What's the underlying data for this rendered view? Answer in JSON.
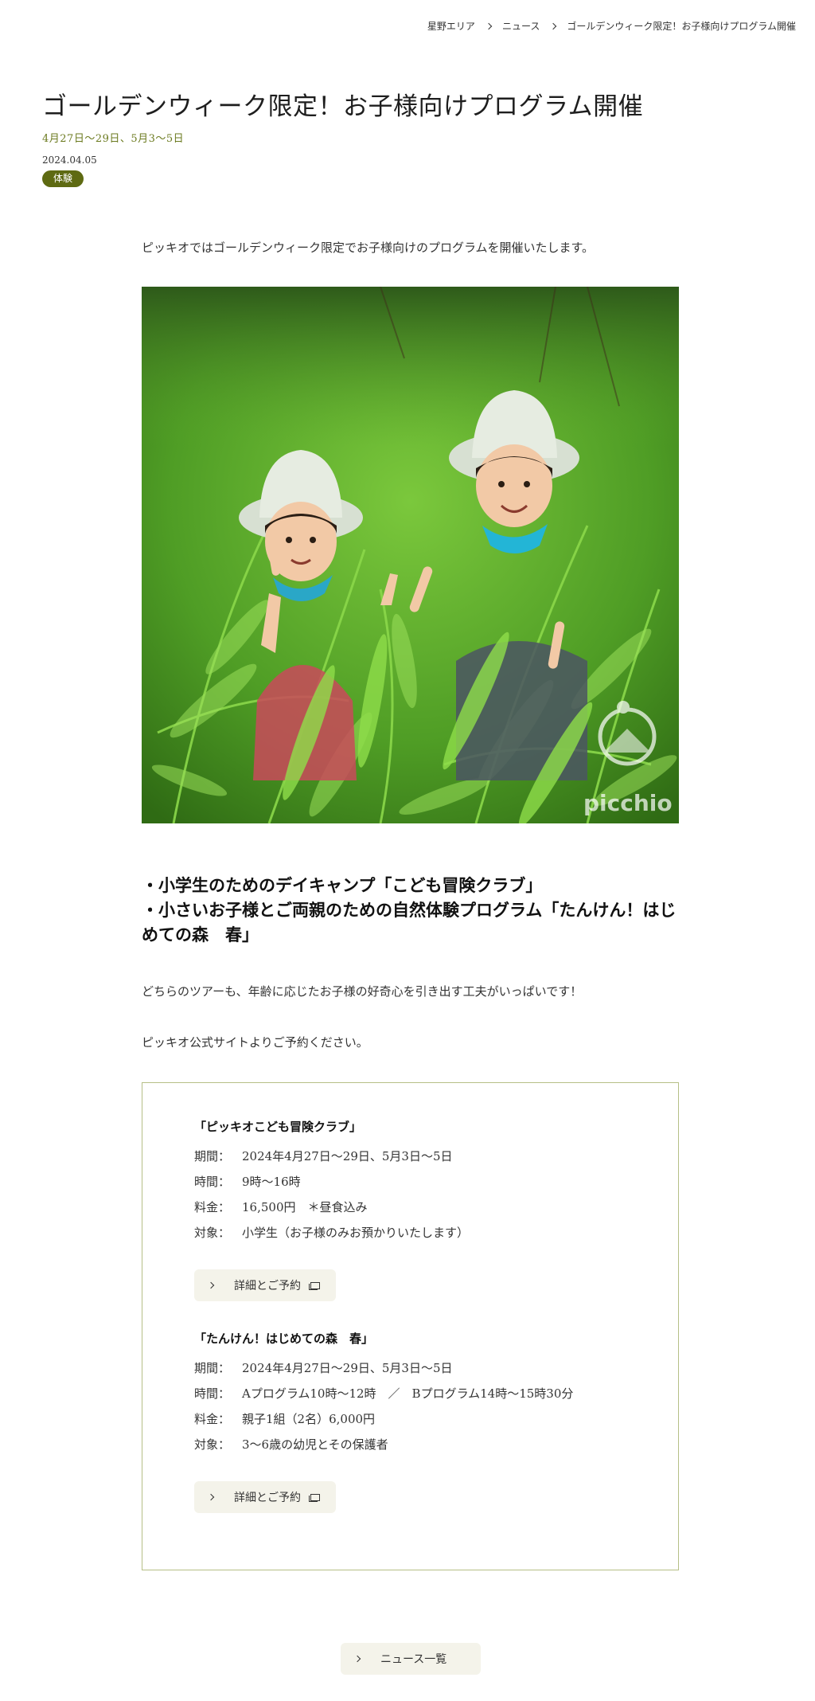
{
  "breadcrumb": {
    "items": [
      "星野エリア",
      "ニュース",
      "ゴールデンウィーク限定！お子様向けプログラム開催"
    ]
  },
  "article": {
    "title": "ゴールデンウィーク限定！お子様向けプログラム開催",
    "period": "4月27日〜29日、5月3〜5日",
    "date": "2024.04.05",
    "category": "体験",
    "intro": "ピッキオではゴールデンウィーク限定でお子様向けのプログラムを開催いたします。",
    "photo_watermark": "picchio",
    "highlights": [
      "・小学生のためのデイキャンプ「こども冒険クラブ」",
      "・小さいお子様とご両親のための自然体験プログラム「たんけん！はじめての森　春」"
    ],
    "paragraph1": "どちらのツアーも、年齢に応じたお子様の好奇心を引き出す工夫がいっぱいです！",
    "paragraph2": "ピッキオ公式サイトよりご予約ください。"
  },
  "programs": [
    {
      "title": "「ピッキオこども冒険クラブ」",
      "rows": [
        {
          "label": "期間：",
          "value": "2024年4月27日〜29日、5月3日〜5日"
        },
        {
          "label": "時間：",
          "value": "9時〜16時"
        },
        {
          "label": "料金：",
          "value": "16,500円　＊昼食込み"
        },
        {
          "label": "対象：",
          "value": "小学生（お子様のみお預かりいたします）"
        }
      ],
      "button_label": "詳細とご予約"
    },
    {
      "title": "「たんけん！はじめての森　春」",
      "rows": [
        {
          "label": "期間：",
          "value": "2024年4月27日〜29日、5月3日〜5日"
        },
        {
          "label": "時間：",
          "value": "Aプログラム10時〜12時　／　Bプログラム14時〜15時30分"
        },
        {
          "label": "料金：",
          "value": "親子1組（2名）6,000円"
        },
        {
          "label": "対象：",
          "value": "3〜6歳の幼児とその保護者"
        }
      ],
      "button_label": "詳細とご予約"
    }
  ],
  "footer": {
    "news_list_label": "ニュース一覧"
  },
  "colors": {
    "accent": "#6b7a1f",
    "badge_bg": "#5e6a12",
    "box_border": "#b6bf86",
    "button_bg": "#f4f3ea"
  }
}
